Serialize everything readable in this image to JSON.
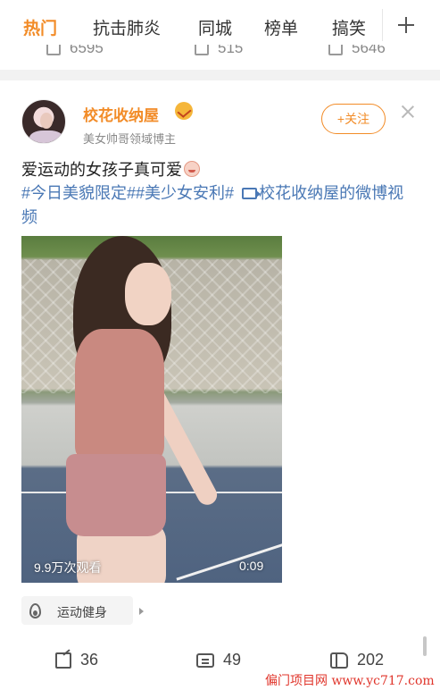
{
  "tabs": [
    {
      "label": "热门",
      "active": true
    },
    {
      "label": "抗击肺炎",
      "active": false
    },
    {
      "label": "同城",
      "active": false
    },
    {
      "label": "榜单",
      "active": false
    },
    {
      "label": "搞笑",
      "active": false
    }
  ],
  "prev_post_stats": {
    "share": "6595",
    "comment": "515",
    "like": "5646"
  },
  "post": {
    "author": {
      "name": "校花收纳屋",
      "tag": "美女帅哥领域博主"
    },
    "follow_label": "+关注",
    "text": "爱运动的女孩子真可爱",
    "hashtags": [
      "#今日美貌限定#",
      "#美少女安利#"
    ],
    "video_link": "校花收纳屋的微博视频",
    "video": {
      "views": "9.9万次观看",
      "duration": "0:09"
    },
    "topic": "运动健身",
    "stats": {
      "share": "36",
      "comment": "49",
      "like": "202"
    }
  },
  "watermark": "偏门项目网 www.yc717.com",
  "colors": {
    "accent": "#f28c28",
    "link": "#4a78b5",
    "watermark": "#e0352b"
  },
  "icons": [
    "plus-icon",
    "verified-badge-icon",
    "close-icon",
    "video-link-icon",
    "flame-icon",
    "chevron-right-icon",
    "share-icon",
    "comment-icon",
    "like-icon"
  ]
}
